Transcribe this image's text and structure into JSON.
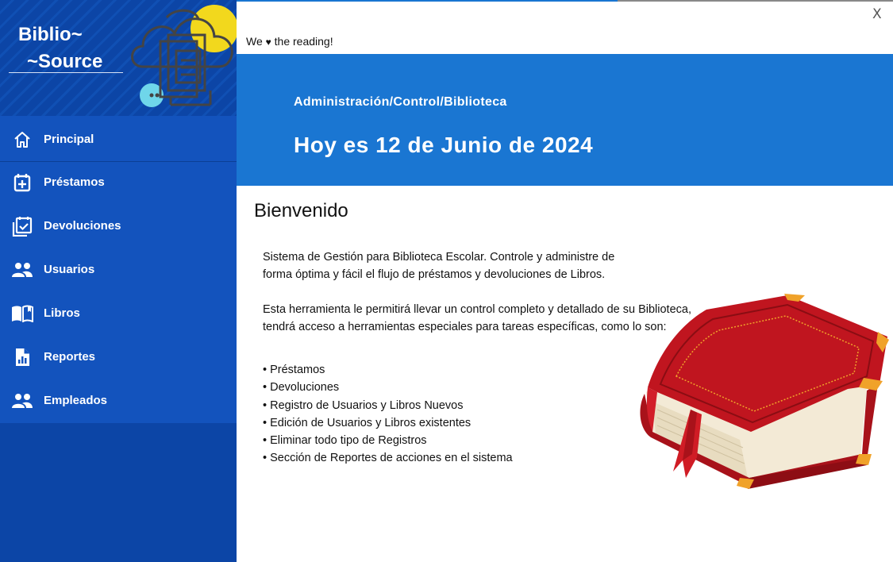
{
  "sidebar": {
    "brand_line1": "Biblio~",
    "brand_line2": "~Source",
    "items": [
      {
        "label": "Principal",
        "icon": "home-icon"
      },
      {
        "label": "Préstamos",
        "icon": "calendar-plus-icon"
      },
      {
        "label": "Devoluciones",
        "icon": "calendar-check-icon"
      },
      {
        "label": "Usuarios",
        "icon": "users-icon"
      },
      {
        "label": "Libros",
        "icon": "open-book-icon"
      },
      {
        "label": "Reportes",
        "icon": "report-icon"
      },
      {
        "label": "Empleados",
        "icon": "users-icon"
      }
    ]
  },
  "window": {
    "close_label": "X"
  },
  "tagline": {
    "before": "We",
    "heart": "♥",
    "after": "the reading!"
  },
  "banner": {
    "path": "Administración/Control/Biblioteca",
    "date": "Hoy es 12 de Junio de 2024"
  },
  "main": {
    "title": "Bienvenido",
    "intro_line1": "Sistema de Gestión para Biblioteca Escolar. Controle y administre de",
    "intro_line2": "forma óptima y fácil el flujo de préstamos y devoluciones de Libros.",
    "tool_line1": "Esta herramienta le permitirá llevar un control completo y detallado de su Biblioteca,",
    "tool_line2": "tendrá acceso a herramientas especiales para tareas específicas, como lo son:",
    "features": [
      "• Préstamos",
      "• Devoluciones",
      "• Registro de Usuarios y Libros Nuevos",
      "• Edición de Usuarios y Libros existentes",
      "• Eliminar todo tipo de Registros",
      "• Sección de Reportes de acciones en el sistema"
    ]
  },
  "colors": {
    "sidebar": "#0c45a6",
    "nav": "#1353bd",
    "banner": "#1a76d2",
    "book_red": "#b3121b",
    "book_gold": "#f0a22a"
  }
}
